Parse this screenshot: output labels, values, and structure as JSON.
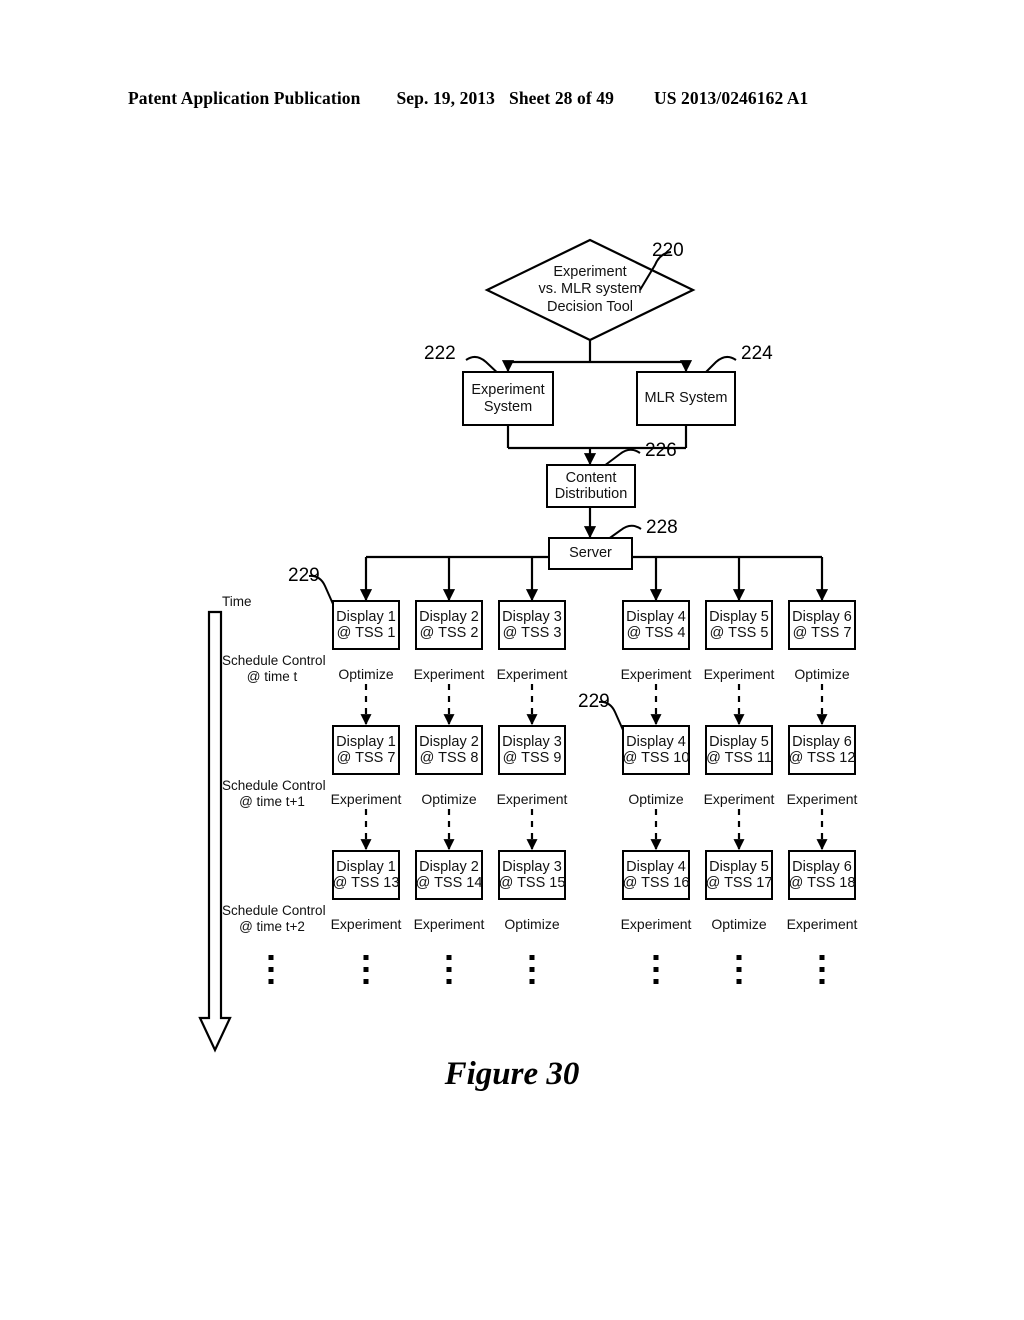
{
  "header": {
    "publication": "Patent Application Publication",
    "date": "Sep. 19, 2013",
    "sheet": "Sheet 28 of 49",
    "number": "US 2013/0246162 A1"
  },
  "caption": "Figure 30",
  "refs": {
    "r220": "220",
    "r222": "222",
    "r224": "224",
    "r226": "226",
    "r228": "228",
    "r229a": "229",
    "r229b": "229"
  },
  "nodes": {
    "decision": {
      "line1": "Experiment",
      "line2": "vs. MLR system",
      "line3": "Decision Tool"
    },
    "experiment_system": {
      "line1": "Experiment",
      "line2": "System"
    },
    "mlr_system": {
      "line1": "MLR System"
    },
    "content_distribution": {
      "line1": "Content",
      "line2": "Distribution"
    },
    "server": {
      "line1": "Server"
    }
  },
  "axis": {
    "time_label": "Time",
    "schedule_rows": [
      {
        "line1": "Schedule Control",
        "line2": "@ time t"
      },
      {
        "line1": "Schedule Control",
        "line2": "@ time t+1"
      },
      {
        "line1": "Schedule Control",
        "line2": "@ time t+2"
      }
    ]
  },
  "grid": {
    "rows": [
      {
        "row_label": "Schedule Control @ time t",
        "cells": [
          {
            "display": "Display 1",
            "tss": "@ TSS 1",
            "status": "Optimize"
          },
          {
            "display": "Display 2",
            "tss": "@ TSS 2",
            "status": "Experiment"
          },
          {
            "display": "Display 3",
            "tss": "@ TSS 3",
            "status": "Experiment"
          },
          {
            "display": "Display 4",
            "tss": "@ TSS 4",
            "status": "Experiment"
          },
          {
            "display": "Display 5",
            "tss": "@ TSS 5",
            "status": "Experiment"
          },
          {
            "display": "Display 6",
            "tss": "@ TSS 7",
            "status": "Optimize"
          }
        ]
      },
      {
        "row_label": "Schedule Control @ time t+1",
        "cells": [
          {
            "display": "Display 1",
            "tss": "@ TSS 7",
            "status": "Experiment"
          },
          {
            "display": "Display 2",
            "tss": "@ TSS 8",
            "status": "Optimize"
          },
          {
            "display": "Display 3",
            "tss": "@ TSS 9",
            "status": "Experiment"
          },
          {
            "display": "Display 4",
            "tss": "@ TSS 10",
            "status": "Optimize"
          },
          {
            "display": "Display 5",
            "tss": "@ TSS 11",
            "status": "Experiment"
          },
          {
            "display": "Display 6",
            "tss": "@ TSS 12",
            "status": "Experiment"
          }
        ]
      },
      {
        "row_label": "Schedule Control @ time t+2",
        "cells": [
          {
            "display": "Display 1",
            "tss": "@ TSS 13",
            "status": "Experiment"
          },
          {
            "display": "Display 2",
            "tss": "@ TSS 14",
            "status": "Experiment"
          },
          {
            "display": "Display 3",
            "tss": "@ TSS 15",
            "status": "Optimize"
          },
          {
            "display": "Display 4",
            "tss": "@ TSS 16",
            "status": "Experiment"
          },
          {
            "display": "Display 5",
            "tss": "@ TSS 17",
            "status": "Optimize"
          },
          {
            "display": "Display 6",
            "tss": "@ TSS 18",
            "status": "Experiment"
          }
        ]
      }
    ]
  },
  "colors": {
    "ink": "#000000",
    "paper": "#ffffff"
  }
}
